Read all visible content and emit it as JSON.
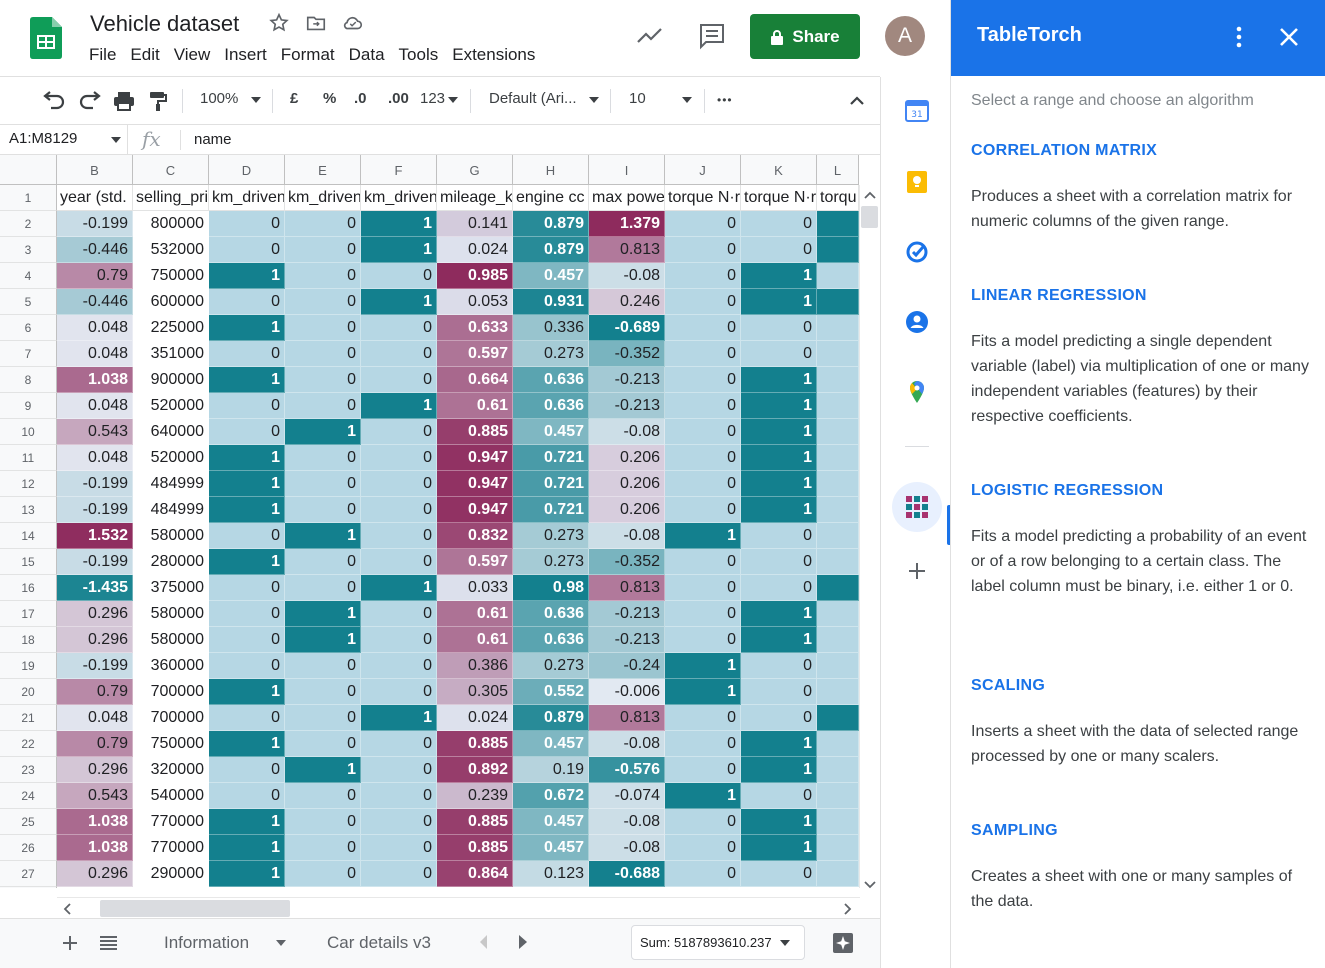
{
  "app": {
    "title": "Vehicle dataset",
    "menu": [
      "File",
      "Edit",
      "View",
      "Insert",
      "Format",
      "Data",
      "Tools",
      "Extensions"
    ],
    "share_label": "Share",
    "avatar_letter": "A"
  },
  "toolbar": {
    "zoom": "100%",
    "currency": "£",
    "percent": "%",
    "dec_decrease": ".0",
    "dec_increase": ".00",
    "number_format": "123",
    "font": "Default (Ari...",
    "font_size": "10",
    "more": "•••"
  },
  "formula_bar": {
    "name_box": "A1:M8129",
    "fx": "fx",
    "value": "name"
  },
  "grid": {
    "columns": [
      "B",
      "C",
      "D",
      "E",
      "F",
      "G",
      "H",
      "I",
      "J",
      "K",
      "L"
    ],
    "headers": [
      "year (std.",
      "selling_pri",
      "km_driven",
      "km_driven",
      "km_driven",
      "mileage_k",
      "engine cc",
      "max powe",
      "torque N·r",
      "torque N·r",
      "torqu"
    ],
    "row_numbers": [
      "1",
      "2",
      "3",
      "4",
      "5",
      "6",
      "7",
      "8",
      "9",
      "10",
      "11",
      "12",
      "13",
      "14",
      "15",
      "16",
      "17",
      "18",
      "19",
      "20",
      "21",
      "22",
      "23",
      "24",
      "25",
      "26",
      "27"
    ],
    "rows": [
      [
        "-0.199",
        "800000",
        "0",
        "0",
        "1",
        "0.141",
        "0.879",
        "1.379",
        "0",
        "0",
        ""
      ],
      [
        "-0.446",
        "532000",
        "0",
        "0",
        "1",
        "0.024",
        "0.879",
        "0.813",
        "0",
        "0",
        ""
      ],
      [
        "0.79",
        "750000",
        "1",
        "0",
        "0",
        "0.985",
        "0.457",
        "-0.08",
        "0",
        "1",
        ""
      ],
      [
        "-0.446",
        "600000",
        "0",
        "0",
        "1",
        "0.053",
        "0.931",
        "0.246",
        "0",
        "1",
        ""
      ],
      [
        "0.048",
        "225000",
        "1",
        "0",
        "0",
        "0.633",
        "0.336",
        "-0.689",
        "0",
        "0",
        ""
      ],
      [
        "0.048",
        "351000",
        "0",
        "0",
        "0",
        "0.597",
        "0.273",
        "-0.352",
        "0",
        "0",
        ""
      ],
      [
        "1.038",
        "900000",
        "1",
        "0",
        "0",
        "0.664",
        "0.636",
        "-0.213",
        "0",
        "1",
        ""
      ],
      [
        "0.048",
        "520000",
        "0",
        "0",
        "1",
        "0.61",
        "0.636",
        "-0.213",
        "0",
        "1",
        ""
      ],
      [
        "0.543",
        "640000",
        "0",
        "1",
        "0",
        "0.885",
        "0.457",
        "-0.08",
        "0",
        "1",
        ""
      ],
      [
        "0.048",
        "520000",
        "1",
        "0",
        "0",
        "0.947",
        "0.721",
        "0.206",
        "0",
        "1",
        ""
      ],
      [
        "-0.199",
        "484999",
        "1",
        "0",
        "0",
        "0.947",
        "0.721",
        "0.206",
        "0",
        "1",
        ""
      ],
      [
        "-0.199",
        "484999",
        "1",
        "0",
        "0",
        "0.947",
        "0.721",
        "0.206",
        "0",
        "1",
        ""
      ],
      [
        "1.532",
        "580000",
        "0",
        "1",
        "0",
        "0.832",
        "0.273",
        "-0.08",
        "1",
        "0",
        ""
      ],
      [
        "-0.199",
        "280000",
        "1",
        "0",
        "0",
        "0.597",
        "0.273",
        "-0.352",
        "0",
        "0",
        ""
      ],
      [
        "-1.435",
        "375000",
        "0",
        "0",
        "1",
        "0.033",
        "0.98",
        "0.813",
        "0",
        "0",
        ""
      ],
      [
        "0.296",
        "580000",
        "0",
        "1",
        "0",
        "0.61",
        "0.636",
        "-0.213",
        "0",
        "1",
        ""
      ],
      [
        "0.296",
        "580000",
        "0",
        "1",
        "0",
        "0.61",
        "0.636",
        "-0.213",
        "0",
        "1",
        ""
      ],
      [
        "-0.199",
        "360000",
        "0",
        "0",
        "0",
        "0.386",
        "0.273",
        "-0.24",
        "1",
        "0",
        ""
      ],
      [
        "0.79",
        "700000",
        "1",
        "0",
        "0",
        "0.305",
        "0.552",
        "-0.006",
        "1",
        "0",
        ""
      ],
      [
        "0.048",
        "700000",
        "0",
        "0",
        "1",
        "0.024",
        "0.879",
        "0.813",
        "0",
        "0",
        ""
      ],
      [
        "0.79",
        "750000",
        "1",
        "0",
        "0",
        "0.885",
        "0.457",
        "-0.08",
        "0",
        "1",
        ""
      ],
      [
        "0.296",
        "320000",
        "0",
        "1",
        "0",
        "0.892",
        "0.19",
        "-0.576",
        "0",
        "1",
        ""
      ],
      [
        "0.543",
        "540000",
        "0",
        "0",
        "0",
        "0.239",
        "0.672",
        "-0.074",
        "1",
        "0",
        ""
      ],
      [
        "1.038",
        "770000",
        "1",
        "0",
        "0",
        "0.885",
        "0.457",
        "-0.08",
        "0",
        "1",
        ""
      ],
      [
        "1.038",
        "770000",
        "1",
        "0",
        "0",
        "0.885",
        "0.457",
        "-0.08",
        "0",
        "1",
        ""
      ],
      [
        "0.296",
        "290000",
        "1",
        "0",
        "0",
        "0.864",
        "0.123",
        "-0.688",
        "0",
        "0",
        ""
      ]
    ],
    "l_column_dark_rows": [
      0,
      1,
      3,
      14,
      19
    ]
  },
  "bottom": {
    "tabs": [
      "Information",
      "Car details v3"
    ],
    "sum": "Sum: 5187893610.237"
  },
  "panel": {
    "title": "TableTorch",
    "subtitle": "Select a range and choose an algorithm",
    "algorithms": [
      {
        "name": "CORRELATION MATRIX",
        "desc": "Produces a sheet with a correlation matrix for numeric columns of the given range."
      },
      {
        "name": "LINEAR REGRESSION",
        "desc": "Fits a model predicting a single dependent variable (label) via multiplication of one or many independent variables (features) by their respective coefficients."
      },
      {
        "name": "LOGISTIC REGRESSION",
        "desc": "Fits a model predicting a probability of an event or of a row belonging to a certain class. The label column must be binary, i.e. either 1 or 0."
      },
      {
        "name": "SCALING",
        "desc": "Inserts a sheet with the data of selected range processed by one or many scalers."
      },
      {
        "name": "SAMPLING",
        "desc": "Creates a sheet with one or many samples of the data."
      }
    ]
  },
  "colors": {
    "teal": "#13808e",
    "light_blue": "#b6d7e4",
    "wine": "#8e2b5d",
    "share_green": "#188038",
    "accent_blue": "#1a73e8"
  }
}
